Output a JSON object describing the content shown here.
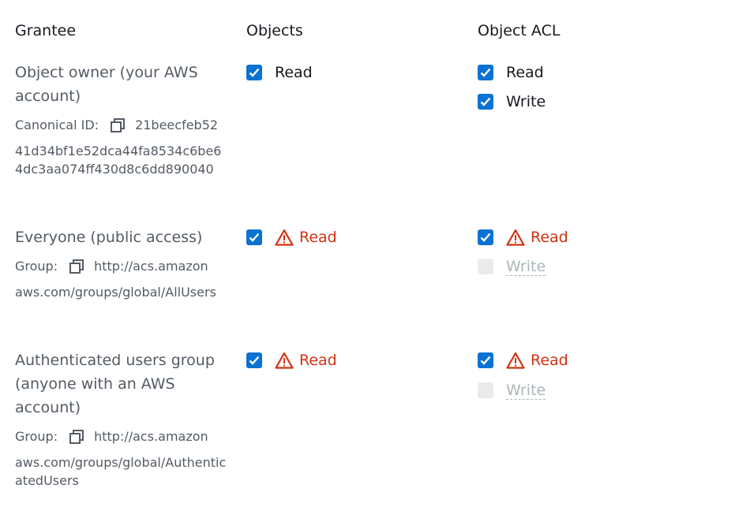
{
  "headers": {
    "grantee": "Grantee",
    "objects": "Objects",
    "object_acl": "Object ACL"
  },
  "colors": {
    "checkbox": "#0972d3",
    "warning": "#d13212",
    "disabled": "#aab7b8"
  },
  "rows": [
    {
      "grantee": "Object owner (your AWS account)",
      "id_label": "Canonical ID:",
      "id_first": "21beecfeb52",
      "id_rest": "41d34bf1e52dca44fa8534c6be64dc3aa074ff430d8c6dd890040",
      "objects_read": {
        "label": "Read",
        "checked": true,
        "warning": false
      },
      "acl_read": {
        "label": "Read",
        "checked": true,
        "warning": false
      },
      "acl_write": {
        "label": "Write",
        "checked": true,
        "disabled": false
      }
    },
    {
      "grantee": "Everyone (public access)",
      "id_label": "Group:",
      "id_first": "http://acs.amazon",
      "id_rest": "aws.com/groups/global/AllUsers",
      "objects_read": {
        "label": "Read",
        "checked": true,
        "warning": true
      },
      "acl_read": {
        "label": "Read",
        "checked": true,
        "warning": true
      },
      "acl_write": {
        "label": "Write",
        "checked": false,
        "disabled": true
      }
    },
    {
      "grantee": "Authenticated users group (anyone with an AWS account)",
      "id_label": "Group:",
      "id_first": "http://acs.amazon",
      "id_rest": "aws.com/groups/global/AuthenticatedUsers",
      "objects_read": {
        "label": "Read",
        "checked": true,
        "warning": true
      },
      "acl_read": {
        "label": "Read",
        "checked": true,
        "warning": true
      },
      "acl_write": {
        "label": "Write",
        "checked": false,
        "disabled": true
      }
    }
  ]
}
